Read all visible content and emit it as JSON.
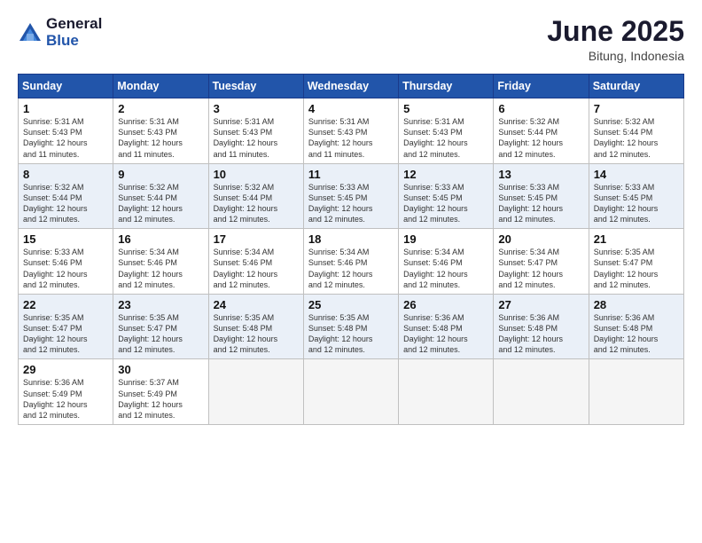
{
  "header": {
    "logo_general": "General",
    "logo_blue": "Blue",
    "title": "June 2025",
    "location": "Bitung, Indonesia"
  },
  "days_of_week": [
    "Sunday",
    "Monday",
    "Tuesday",
    "Wednesday",
    "Thursday",
    "Friday",
    "Saturday"
  ],
  "weeks": [
    [
      {
        "day": "1",
        "sunrise": "Sunrise: 5:31 AM",
        "sunset": "Sunset: 5:43 PM",
        "daylight": "Daylight: 12 hours and 11 minutes."
      },
      {
        "day": "2",
        "sunrise": "Sunrise: 5:31 AM",
        "sunset": "Sunset: 5:43 PM",
        "daylight": "Daylight: 12 hours and 11 minutes."
      },
      {
        "day": "3",
        "sunrise": "Sunrise: 5:31 AM",
        "sunset": "Sunset: 5:43 PM",
        "daylight": "Daylight: 12 hours and 11 minutes."
      },
      {
        "day": "4",
        "sunrise": "Sunrise: 5:31 AM",
        "sunset": "Sunset: 5:43 PM",
        "daylight": "Daylight: 12 hours and 11 minutes."
      },
      {
        "day": "5",
        "sunrise": "Sunrise: 5:31 AM",
        "sunset": "Sunset: 5:43 PM",
        "daylight": "Daylight: 12 hours and 12 minutes."
      },
      {
        "day": "6",
        "sunrise": "Sunrise: 5:32 AM",
        "sunset": "Sunset: 5:44 PM",
        "daylight": "Daylight: 12 hours and 12 minutes."
      },
      {
        "day": "7",
        "sunrise": "Sunrise: 5:32 AM",
        "sunset": "Sunset: 5:44 PM",
        "daylight": "Daylight: 12 hours and 12 minutes."
      }
    ],
    [
      {
        "day": "8",
        "sunrise": "Sunrise: 5:32 AM",
        "sunset": "Sunset: 5:44 PM",
        "daylight": "Daylight: 12 hours and 12 minutes."
      },
      {
        "day": "9",
        "sunrise": "Sunrise: 5:32 AM",
        "sunset": "Sunset: 5:44 PM",
        "daylight": "Daylight: 12 hours and 12 minutes."
      },
      {
        "day": "10",
        "sunrise": "Sunrise: 5:32 AM",
        "sunset": "Sunset: 5:44 PM",
        "daylight": "Daylight: 12 hours and 12 minutes."
      },
      {
        "day": "11",
        "sunrise": "Sunrise: 5:33 AM",
        "sunset": "Sunset: 5:45 PM",
        "daylight": "Daylight: 12 hours and 12 minutes."
      },
      {
        "day": "12",
        "sunrise": "Sunrise: 5:33 AM",
        "sunset": "Sunset: 5:45 PM",
        "daylight": "Daylight: 12 hours and 12 minutes."
      },
      {
        "day": "13",
        "sunrise": "Sunrise: 5:33 AM",
        "sunset": "Sunset: 5:45 PM",
        "daylight": "Daylight: 12 hours and 12 minutes."
      },
      {
        "day": "14",
        "sunrise": "Sunrise: 5:33 AM",
        "sunset": "Sunset: 5:45 PM",
        "daylight": "Daylight: 12 hours and 12 minutes."
      }
    ],
    [
      {
        "day": "15",
        "sunrise": "Sunrise: 5:33 AM",
        "sunset": "Sunset: 5:46 PM",
        "daylight": "Daylight: 12 hours and 12 minutes."
      },
      {
        "day": "16",
        "sunrise": "Sunrise: 5:34 AM",
        "sunset": "Sunset: 5:46 PM",
        "daylight": "Daylight: 12 hours and 12 minutes."
      },
      {
        "day": "17",
        "sunrise": "Sunrise: 5:34 AM",
        "sunset": "Sunset: 5:46 PM",
        "daylight": "Daylight: 12 hours and 12 minutes."
      },
      {
        "day": "18",
        "sunrise": "Sunrise: 5:34 AM",
        "sunset": "Sunset: 5:46 PM",
        "daylight": "Daylight: 12 hours and 12 minutes."
      },
      {
        "day": "19",
        "sunrise": "Sunrise: 5:34 AM",
        "sunset": "Sunset: 5:46 PM",
        "daylight": "Daylight: 12 hours and 12 minutes."
      },
      {
        "day": "20",
        "sunrise": "Sunrise: 5:34 AM",
        "sunset": "Sunset: 5:47 PM",
        "daylight": "Daylight: 12 hours and 12 minutes."
      },
      {
        "day": "21",
        "sunrise": "Sunrise: 5:35 AM",
        "sunset": "Sunset: 5:47 PM",
        "daylight": "Daylight: 12 hours and 12 minutes."
      }
    ],
    [
      {
        "day": "22",
        "sunrise": "Sunrise: 5:35 AM",
        "sunset": "Sunset: 5:47 PM",
        "daylight": "Daylight: 12 hours and 12 minutes."
      },
      {
        "day": "23",
        "sunrise": "Sunrise: 5:35 AM",
        "sunset": "Sunset: 5:47 PM",
        "daylight": "Daylight: 12 hours and 12 minutes."
      },
      {
        "day": "24",
        "sunrise": "Sunrise: 5:35 AM",
        "sunset": "Sunset: 5:48 PM",
        "daylight": "Daylight: 12 hours and 12 minutes."
      },
      {
        "day": "25",
        "sunrise": "Sunrise: 5:35 AM",
        "sunset": "Sunset: 5:48 PM",
        "daylight": "Daylight: 12 hours and 12 minutes."
      },
      {
        "day": "26",
        "sunrise": "Sunrise: 5:36 AM",
        "sunset": "Sunset: 5:48 PM",
        "daylight": "Daylight: 12 hours and 12 minutes."
      },
      {
        "day": "27",
        "sunrise": "Sunrise: 5:36 AM",
        "sunset": "Sunset: 5:48 PM",
        "daylight": "Daylight: 12 hours and 12 minutes."
      },
      {
        "day": "28",
        "sunrise": "Sunrise: 5:36 AM",
        "sunset": "Sunset: 5:48 PM",
        "daylight": "Daylight: 12 hours and 12 minutes."
      }
    ],
    [
      {
        "day": "29",
        "sunrise": "Sunrise: 5:36 AM",
        "sunset": "Sunset: 5:49 PM",
        "daylight": "Daylight: 12 hours and 12 minutes."
      },
      {
        "day": "30",
        "sunrise": "Sunrise: 5:37 AM",
        "sunset": "Sunset: 5:49 PM",
        "daylight": "Daylight: 12 hours and 12 minutes."
      },
      {
        "day": "",
        "sunrise": "",
        "sunset": "",
        "daylight": ""
      },
      {
        "day": "",
        "sunrise": "",
        "sunset": "",
        "daylight": ""
      },
      {
        "day": "",
        "sunrise": "",
        "sunset": "",
        "daylight": ""
      },
      {
        "day": "",
        "sunrise": "",
        "sunset": "",
        "daylight": ""
      },
      {
        "day": "",
        "sunrise": "",
        "sunset": "",
        "daylight": ""
      }
    ]
  ],
  "row_colors": [
    "#ffffff",
    "#eaf0f8",
    "#ffffff",
    "#eaf0f8",
    "#ffffff"
  ]
}
